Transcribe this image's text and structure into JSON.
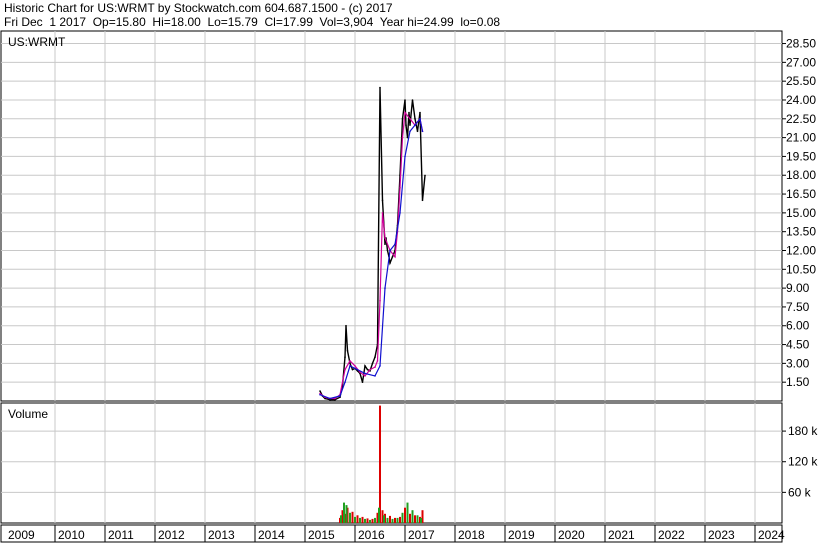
{
  "header": {
    "line1": "Historic Chart for US:WRMT by Stockwatch.com 604.687.1500 - (c) 2017",
    "line2": "Fri Dec  1 2017  Op=15.80  Hi=18.00  Lo=15.79  Cl=17.99  Vol=3,904  Year hi=24.99  lo=0.08"
  },
  "chart_data": [
    {
      "type": "line",
      "title": "US:WRMT",
      "ylim": [
        0,
        29.5
      ],
      "y_ticks": [
        "28.50",
        "27.00",
        "25.50",
        "24.00",
        "22.50",
        "21.00",
        "19.50",
        "18.00",
        "16.50",
        "15.00",
        "13.50",
        "12.00",
        "10.50",
        "9.00",
        "7.50",
        "6.00",
        "4.50",
        "3.00",
        "1.50"
      ],
      "x_ticks": [
        "2009",
        "2010",
        "2011",
        "2012",
        "2013",
        "2014",
        "2015",
        "2016",
        "2017",
        "2018",
        "2019",
        "2020",
        "2021",
        "2022",
        "2023",
        "2024"
      ],
      "grid": true,
      "series": [
        {
          "color": "#000000",
          "x": [
            2015.3,
            2015.35,
            2015.4,
            2015.5,
            2015.6,
            2015.7,
            2015.75,
            2015.8,
            2015.82,
            2015.85,
            2015.9,
            2015.95,
            2016.0,
            2016.05,
            2016.1,
            2016.15,
            2016.2,
            2016.25,
            2016.3,
            2016.35,
            2016.4,
            2016.45,
            2016.5,
            2016.55,
            2016.6,
            2016.62,
            2016.65,
            2016.68,
            2016.7,
            2016.75,
            2016.8,
            2016.85,
            2016.9,
            2016.95,
            2017.0,
            2017.02,
            2017.05,
            2017.08,
            2017.1,
            2017.15,
            2017.2,
            2017.25,
            2017.3,
            2017.35,
            2017.4
          ],
          "values": [
            0.8,
            0.4,
            0.2,
            0.1,
            0.1,
            0.3,
            1.2,
            3.5,
            6.0,
            4.0,
            3.0,
            2.5,
            2.6,
            2.4,
            2.2,
            1.5,
            2.8,
            2.5,
            2.4,
            3.0,
            3.5,
            4.5,
            24.99,
            16.0,
            12.5,
            13.0,
            12.0,
            11.5,
            11.0,
            11.5,
            12.0,
            14.0,
            18.0,
            22.5,
            24.0,
            22.0,
            21.0,
            23.0,
            22.0,
            24.0,
            22.5,
            21.5,
            23.0,
            16.0,
            17.99
          ]
        },
        {
          "color": "#d0009a",
          "x": [
            2015.3,
            2015.4,
            2015.5,
            2015.6,
            2015.7,
            2015.8,
            2015.9,
            2016.0,
            2016.1,
            2016.2,
            2016.3,
            2016.4,
            2016.45,
            2016.5,
            2016.55,
            2016.6,
            2016.7,
            2016.8,
            2016.85,
            2016.9,
            2016.95,
            2017.0,
            2017.1,
            2017.2,
            2017.3,
            2017.35
          ],
          "values": [
            0.6,
            0.3,
            0.2,
            0.2,
            0.5,
            2.5,
            3.2,
            2.8,
            2.3,
            2.0,
            2.5,
            2.7,
            3.2,
            8.0,
            15.0,
            13.0,
            12.0,
            11.5,
            13.5,
            17.0,
            21.0,
            23.0,
            22.5,
            22.0,
            22.5,
            21.5
          ]
        },
        {
          "color": "#1010d0",
          "x": [
            2015.3,
            2015.5,
            2015.7,
            2015.8,
            2015.9,
            2016.0,
            2016.2,
            2016.4,
            2016.5,
            2016.6,
            2016.7,
            2016.8,
            2016.9,
            2017.0,
            2017.1,
            2017.2,
            2017.3,
            2017.35
          ],
          "values": [
            0.5,
            0.2,
            0.4,
            1.5,
            2.8,
            2.6,
            2.2,
            2.0,
            2.8,
            9.0,
            12.0,
            12.5,
            15.0,
            19.5,
            21.5,
            22.0,
            22.5,
            21.5
          ]
        }
      ]
    },
    {
      "type": "bar",
      "title": "Volume",
      "ylim": [
        0,
        235
      ],
      "y_ticks": [
        "180 k",
        "120 k",
        "60 k"
      ],
      "y_tick_values": [
        180,
        120,
        60
      ],
      "series": [
        {
          "color": "#dd0000",
          "x": [
            2015.7,
            2015.75,
            2015.8,
            2015.85,
            2015.95,
            2016.05,
            2016.15,
            2016.25,
            2016.35,
            2016.45,
            2016.5,
            2016.55,
            2016.6,
            2016.7,
            2016.8,
            2016.9,
            2017.0,
            2017.1,
            2017.2,
            2017.3,
            2017.35
          ],
          "values": [
            10,
            25,
            18,
            30,
            22,
            15,
            12,
            9,
            8,
            20,
            230,
            25,
            18,
            14,
            10,
            12,
            30,
            18,
            15,
            12,
            25
          ]
        },
        {
          "color": "#20a020",
          "x": [
            2015.72,
            2015.78,
            2015.83,
            2015.9,
            2016.0,
            2016.1,
            2016.2,
            2016.3,
            2016.4,
            2016.48,
            2016.58,
            2016.65,
            2016.75,
            2016.85,
            2016.95,
            2017.05,
            2017.15,
            2017.25,
            2017.32
          ],
          "values": [
            15,
            40,
            35,
            20,
            12,
            10,
            8,
            6,
            10,
            30,
            15,
            10,
            8,
            10,
            20,
            40,
            25,
            15,
            10
          ]
        }
      ]
    }
  ]
}
